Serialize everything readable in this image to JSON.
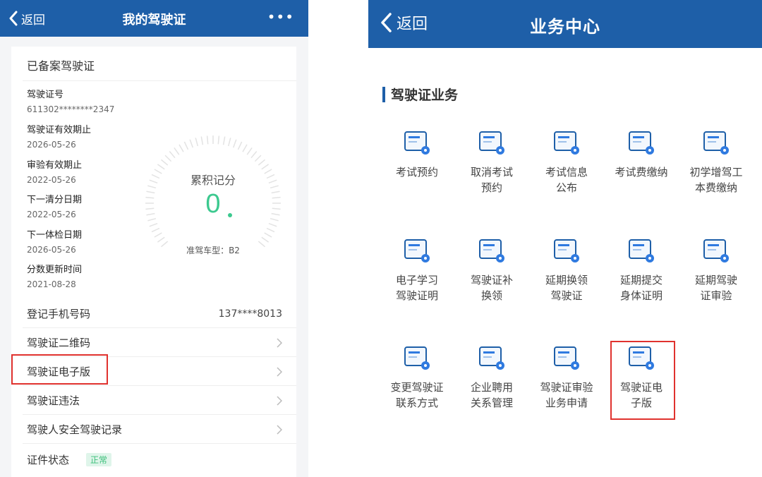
{
  "left": {
    "nav": {
      "back": "返回",
      "title": "我的驾驶证",
      "more": "•••"
    },
    "heading": "已备案驾驶证",
    "info": [
      {
        "label": "驾驶证号",
        "value": "611302********2347"
      },
      {
        "label": "驾驶证有效期止",
        "value": "2026-05-26"
      },
      {
        "label": "审验有效期止",
        "value": "2022-05-26"
      },
      {
        "label": "下一清分日期",
        "value": "2022-05-26"
      },
      {
        "label": "下一体检日期",
        "value": "2026-05-26"
      },
      {
        "label": "分数更新时间",
        "value": "2021-08-28"
      }
    ],
    "gauge": {
      "title": "累积记分",
      "score": "0",
      "vehicle": "准驾车型：B2"
    },
    "menu": [
      {
        "label": "登记手机号码",
        "value": "137****8013"
      },
      {
        "label": "驾驶证二维码"
      },
      {
        "label": "驾驶证电子版"
      },
      {
        "label": "驾驶证违法"
      },
      {
        "label": "驾驶人安全驾驶记录"
      },
      {
        "label": "证件状态",
        "badge": "正常"
      }
    ]
  },
  "right": {
    "nav": {
      "back": "返回",
      "title": "业务中心"
    },
    "section": "驾驶证业务",
    "tiles": [
      {
        "line1": "考试预约",
        "line2": "",
        "icon": "exam-booking-icon"
      },
      {
        "line1": "取消考试",
        "line2": "预约",
        "icon": "calendar-cancel-icon"
      },
      {
        "line1": "考试信息",
        "line2": "公布",
        "icon": "exam-info-icon"
      },
      {
        "line1": "考试费缴纳",
        "line2": "",
        "icon": "fee-payment-icon"
      },
      {
        "line1": "初学增驾工",
        "line2": "本费缴纳",
        "icon": "cost-payment-icon"
      },
      {
        "line1": "电子学习",
        "line2": "驾驶证明",
        "icon": "e-learning-icon"
      },
      {
        "line1": "驾驶证补",
        "line2": "换领",
        "icon": "license-replace-icon"
      },
      {
        "line1": "延期换领",
        "line2": "驾驶证",
        "icon": "delay-renew-icon"
      },
      {
        "line1": "延期提交",
        "line2": "身体证明",
        "icon": "health-proof-icon"
      },
      {
        "line1": "延期驾驶",
        "line2": "证审验",
        "icon": "delay-review-icon"
      },
      {
        "line1": "变更驾驶证",
        "line2": "联系方式",
        "icon": "contact-change-icon"
      },
      {
        "line1": "企业聘用",
        "line2": "关系管理",
        "icon": "enterprise-icon"
      },
      {
        "line1": "驾驶证审验",
        "line2": "业务申请",
        "icon": "review-apply-icon"
      },
      {
        "line1": "驾驶证电",
        "line2": "子版",
        "icon": "e-license-icon"
      }
    ]
  },
  "colors": {
    "brand": "#1e5fa8",
    "accent_green": "#3cc98f",
    "highlight_red": "#e0322e"
  }
}
